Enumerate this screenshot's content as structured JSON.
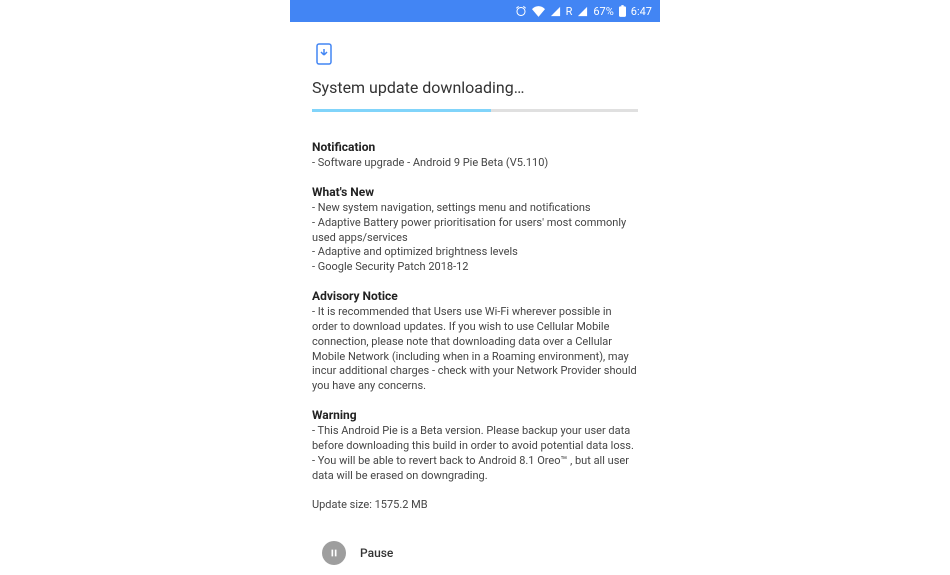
{
  "status_bar": {
    "roaming_label": "R",
    "battery_pct": "67%",
    "time": "6:47"
  },
  "page": {
    "title": "System update downloading…",
    "progress_pct": 55
  },
  "sections": {
    "notification": {
      "heading": "Notification",
      "items": [
        "- Software upgrade - Android 9 Pie Beta (V5.110)"
      ]
    },
    "whats_new": {
      "heading": "What's New",
      "items": [
        "- New system navigation, settings menu and notifications",
        "- Adaptive Battery power prioritisation for users' most commonly used apps/services",
        "- Adaptive and optimized brightness levels",
        "- Google Security Patch 2018-12"
      ]
    },
    "advisory": {
      "heading": "Advisory Notice",
      "items": [
        "- It is recommended that Users use Wi-Fi wherever possible in order to download updates. If you wish to use Cellular Mobile connection, please note that downloading data over a Cellular Mobile Network (including when in a Roaming environment), may incur additional charges - check with your Network Provider should you have any concerns."
      ]
    },
    "warning": {
      "heading": "Warning",
      "items": [
        "- This Android Pie is a Beta version. Please backup your user data before downloading this build in order to avoid potential data loss.",
        "- You will be able to revert back to Android 8.1 Oreo™ , but all user data will be erased on downgrading."
      ]
    }
  },
  "update_size": "Update size: 1575.2 MB",
  "pause_label": "Pause"
}
